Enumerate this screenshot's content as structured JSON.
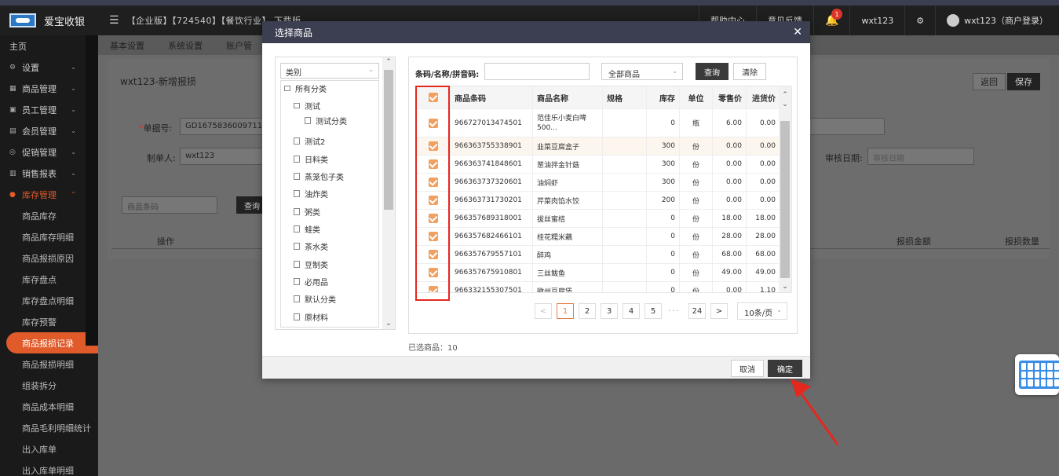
{
  "app": {
    "name": "爱宝收银",
    "info": "【企业版】【724540】【餐饮行业】 下载版",
    "top_links": [
      "帮助中心",
      "意见反馈"
    ],
    "notif_count": "1",
    "user_short": "wxt123",
    "user_full": "wxt123（商户登录）"
  },
  "sidebar": {
    "items": [
      {
        "label": "主页"
      },
      {
        "label": "设置"
      },
      {
        "label": "商品管理"
      },
      {
        "label": "员工管理"
      },
      {
        "label": "会员管理"
      },
      {
        "label": "促销管理"
      },
      {
        "label": "销售报表"
      },
      {
        "label": "库存管理"
      }
    ],
    "subs": [
      {
        "label": "商品库存"
      },
      {
        "label": "商品库存明细"
      },
      {
        "label": "商品报损原因"
      },
      {
        "label": "库存盘点"
      },
      {
        "label": "库存盘点明细"
      },
      {
        "label": "库存预警"
      },
      {
        "label": "商品报损记录"
      },
      {
        "label": "商品报损明细"
      },
      {
        "label": "组装拆分"
      },
      {
        "label": "商品成本明细"
      },
      {
        "label": "商品毛利明细统计"
      },
      {
        "label": "出入库单"
      },
      {
        "label": "出入库单明细"
      }
    ]
  },
  "content": {
    "tabs": [
      "基本设置",
      "系统设置",
      "账户管"
    ],
    "title": "wxt123-新增报损",
    "back_label": "返回",
    "save_label": "保存",
    "order_no_label": "单据号:",
    "order_no": "GD1675836009711",
    "maker_label": "制单人:",
    "maker": "wxt123",
    "audit_date_label": "审核日期:",
    "audit_date_placeholder": "审核日期",
    "search_placeholder": "商品条码",
    "search_btn": "查询",
    "cols": [
      "操作",
      "报损金额",
      "报损数量"
    ]
  },
  "modal": {
    "title": "选择商品",
    "category_select": "类别",
    "categories": [
      {
        "label": "所有分类",
        "level": 0
      },
      {
        "label": "测试",
        "level": 1
      },
      {
        "label": "测试分类",
        "level": 2
      },
      {
        "label": "测试2",
        "level": 1
      },
      {
        "label": "日料类",
        "level": 1
      },
      {
        "label": "蒸笼包子类",
        "level": 1
      },
      {
        "label": "油炸类",
        "level": 1
      },
      {
        "label": "粥类",
        "level": 1
      },
      {
        "label": "蛙类",
        "level": 1
      },
      {
        "label": "茶水类",
        "level": 1
      },
      {
        "label": "豆制类",
        "level": 1
      },
      {
        "label": "必用品",
        "level": 1
      },
      {
        "label": "默认分类",
        "level": 1
      },
      {
        "label": "原材料",
        "level": 1
      }
    ],
    "search_label": "条码/名称/拼音码:",
    "search_value": "",
    "scope_select": "全部商品",
    "query_btn": "查询",
    "clear_btn": "清除",
    "headers": [
      "商品条码",
      "商品名称",
      "规格",
      "库存",
      "单位",
      "零售价",
      "进货价"
    ],
    "rows": [
      {
        "barcode": "966727013474501",
        "name": "范佳乐小麦白啤500...",
        "spec": "",
        "stock": "0",
        "unit": "瓶",
        "retail": "6.00",
        "cost": "0.00"
      },
      {
        "barcode": "966363755338901",
        "name": "韭菜豆腐盒子",
        "spec": "",
        "stock": "300",
        "unit": "份",
        "retail": "0.00",
        "cost": "0.00"
      },
      {
        "barcode": "966363741848601",
        "name": "葱油拌金针菇",
        "spec": "",
        "stock": "300",
        "unit": "份",
        "retail": "0.00",
        "cost": "0.00"
      },
      {
        "barcode": "966363737320601",
        "name": "油焖虾",
        "spec": "",
        "stock": "300",
        "unit": "份",
        "retail": "0.00",
        "cost": "0.00"
      },
      {
        "barcode": "966363731730201",
        "name": "芹菜肉馅水饺",
        "spec": "",
        "stock": "200",
        "unit": "份",
        "retail": "0.00",
        "cost": "0.00"
      },
      {
        "barcode": "966357689318001",
        "name": "拔丝蜜桔",
        "spec": "",
        "stock": "0",
        "unit": "份",
        "retail": "18.00",
        "cost": "18.00"
      },
      {
        "barcode": "966357682466101",
        "name": "桂花糯米藕",
        "spec": "",
        "stock": "0",
        "unit": "份",
        "retail": "28.00",
        "cost": "28.00"
      },
      {
        "barcode": "966357679557101",
        "name": "醉鸡",
        "spec": "",
        "stock": "0",
        "unit": "份",
        "retail": "68.00",
        "cost": "68.00"
      },
      {
        "barcode": "966357675910801",
        "name": "三丝鲅鱼",
        "spec": "",
        "stock": "0",
        "unit": "份",
        "retail": "49.00",
        "cost": "49.00"
      },
      {
        "barcode": "966332155307501",
        "name": "徽州豆腐煲",
        "spec": "",
        "stock": "0",
        "unit": "份",
        "retail": "0.00",
        "cost": "1.10"
      }
    ],
    "pager": {
      "prev": "<",
      "pages": [
        "1",
        "2",
        "3",
        "4",
        "5"
      ],
      "dots": "···",
      "last": "24",
      "next": ">",
      "page_size": "10条/页",
      "current": "1"
    },
    "selected_text": "已选商品：10",
    "cancel_btn": "取消",
    "ok_btn": "确定"
  },
  "colors": {
    "accent": "#e05a2a",
    "checkbox": "#f0a060",
    "highlight_border": "#e5281e",
    "modal_header": "#3c3f52"
  }
}
